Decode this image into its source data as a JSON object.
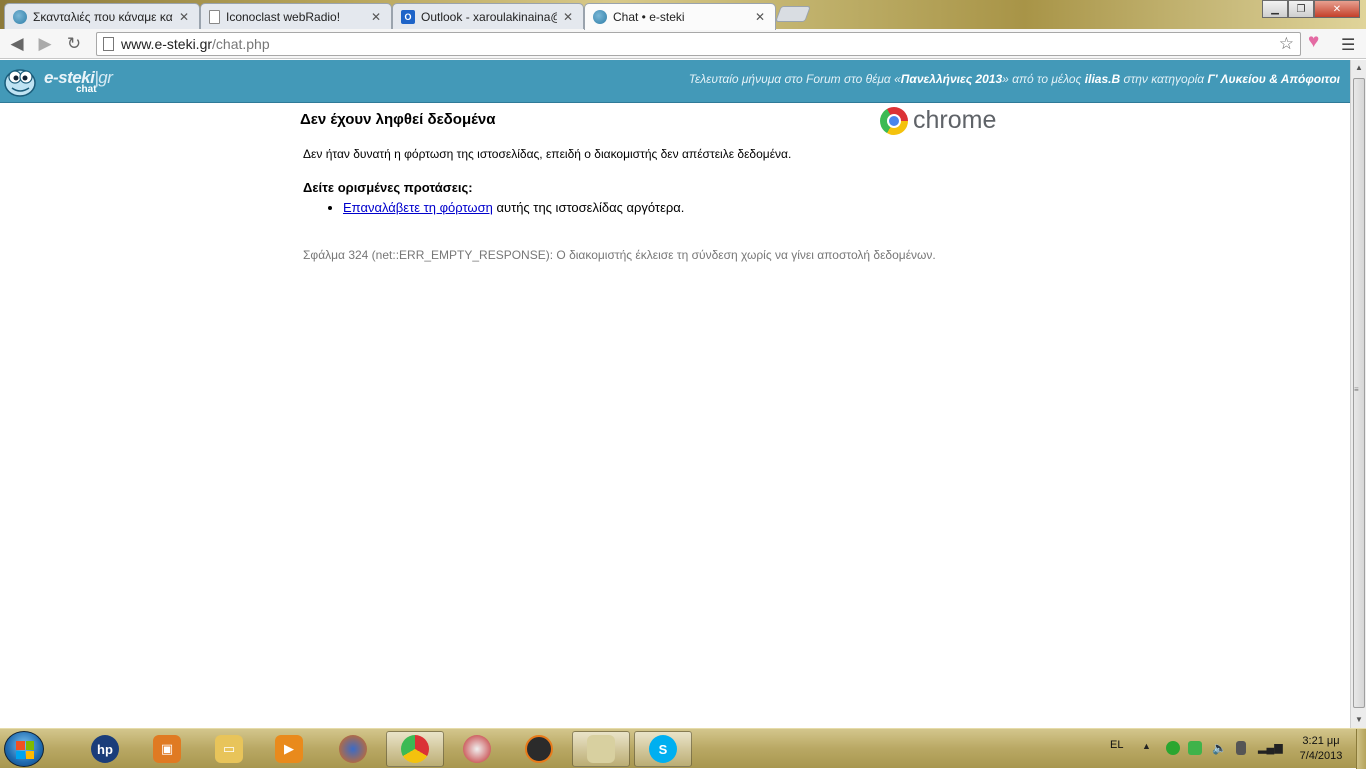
{
  "browser": {
    "tabs": [
      {
        "title": "Σκανταλιές που κάναμε κα",
        "favicon": "e-steki-icon",
        "active": false
      },
      {
        "title": "Iconoclast webRadio!",
        "favicon": "page-icon",
        "active": false
      },
      {
        "title": "Outlook - xaroulakinaina@",
        "favicon": "outlook-icon",
        "active": false
      },
      {
        "title": "Chat • e-steki",
        "favicon": "e-steki-icon",
        "active": true
      }
    ],
    "url_host": "www.e-steki.gr",
    "url_path": "/chat.php"
  },
  "site": {
    "brand": "e-steki",
    "brand_suffix": "gr",
    "chat_label": "chat",
    "ticker_prefix": "Τελευταίο μήνυμα στο Forum στο θέμα «",
    "ticker_topic": "Πανελλήνιες 2013",
    "ticker_mid": "» από το μέλος ",
    "ticker_user": "ilias.B",
    "ticker_cat_prefix": " στην κατηγορία ",
    "ticker_category": "Γ' Λυκείου & Απόφοιτοι"
  },
  "error": {
    "title": "Δεν έχουν ληφθεί δεδομένα",
    "logo_text": "chrome",
    "message": "Δεν ήταν δυνατή η φόρτωση της ιστοσελίδας, επειδή ο διακομιστής δεν απέστειλε δεδομένα.",
    "suggestions_heading": "Δείτε ορισμένες προτάσεις:",
    "reload_link": "Επαναλάβετε τη φόρτωση",
    "reload_rest": " αυτής της ιστοσελίδας αργότερα.",
    "code": "Σφάλμα 324 (net::ERR_EMPTY_RESPONSE): Ο διακομιστής έκλεισε τη σύνδεση χωρίς να γίνει αποστολή δεδομένων."
  },
  "taskbar": {
    "language": "EL",
    "time": "3:21 μμ",
    "date": "7/4/2013"
  }
}
